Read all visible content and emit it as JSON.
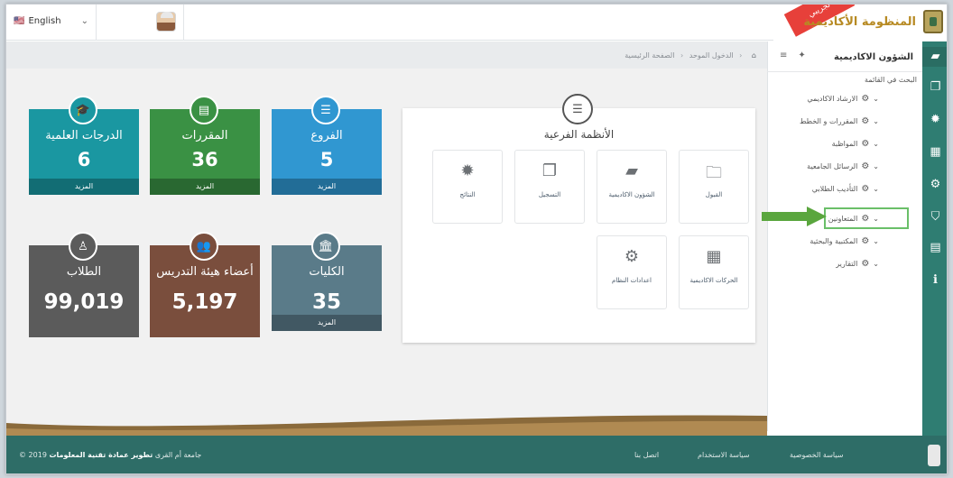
{
  "topbar": {
    "language": "English",
    "language_flag": "🇺🇸"
  },
  "brand": {
    "name": "المنظومة الأكاديمية",
    "trial_badge": "تجريبي"
  },
  "breadcrumb": {
    "home_icon": "home-icon",
    "items": [
      "الدخول الموحد",
      "الصفحة الرئيسية"
    ]
  },
  "stats": [
    {
      "title": "الفروع",
      "value": "5",
      "more": "المزيد",
      "color": "#3097d1",
      "icon": "list-icon"
    },
    {
      "title": "المقررات",
      "value": "36",
      "more": "المزيد",
      "color": "#3a9144",
      "icon": "book-icon"
    },
    {
      "title": "الدرجات العلمية",
      "value": "6",
      "more": "المزيد",
      "color": "#1a97a1",
      "icon": "graduation-cap-icon"
    },
    {
      "title": "الكليات",
      "value": "35",
      "more": "المزيد",
      "color": "#5a7b89",
      "icon": "institution-icon"
    },
    {
      "title": "أعضاء هيئة التدريس",
      "value": "5,197",
      "more": "",
      "color": "#7a4e3d",
      "icon": "users-icon"
    },
    {
      "title": "الطلاب",
      "value": "99,019",
      "more": "",
      "color": "#5b5b5b",
      "icon": "student-icon"
    }
  ],
  "subsystems": {
    "title": "الأنظمة الفرعية",
    "cards": [
      {
        "label": "القبول",
        "icon": "folder-icon"
      },
      {
        "label": "الشؤون الاكاديمية",
        "icon": "book-icon"
      },
      {
        "label": "التسجيل",
        "icon": "copy-icon"
      },
      {
        "label": "النتائج",
        "icon": "badge-icon"
      },
      {
        "label": "الحركات الاكاديمية",
        "icon": "newspaper-icon"
      },
      {
        "label": "اعدادات النظام",
        "icon": "cogs-icon"
      }
    ]
  },
  "sidebar": {
    "title": "الشؤون الاكاديمية",
    "search_label": "البحث في القائمة",
    "items": [
      "الارشاد الاكاديمي",
      "المقررات و الخطط",
      "المواظبة",
      "الرسائل الجامعية",
      "التأديب الطلابي",
      "المتعاونين",
      "المكتبية والبحثية",
      "التقارير"
    ],
    "highlighted_item": "المتعاونين"
  },
  "footer": {
    "copyright": "© 2019 جامعة أم القرى",
    "developer": "تطوير عمادة تقنية المعلومات",
    "links": [
      "اتصل بنا",
      "سياسة الاستخدام",
      "سياسة الخصوصية"
    ]
  },
  "colors": {
    "iconbar": "#2f7d72",
    "footer": "#2e6d67",
    "arrow": "#5aa63e",
    "highlight_border": "#6abf69"
  }
}
